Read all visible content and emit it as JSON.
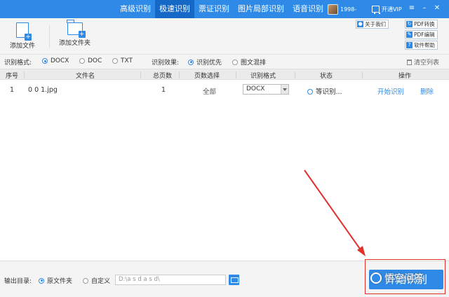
{
  "topbar": {
    "tabs": [
      "高级识别",
      "极速识别",
      "票证识别",
      "图片局部识别",
      "语音识别"
    ],
    "active_tab": "极速识别",
    "user_name": "1998-",
    "vip_label": "开通VIP",
    "color": "#2e8ae6"
  },
  "toolbar": {
    "add_file": "添加文件",
    "add_folder": "添加文件夹",
    "about": "关于我们",
    "pdf_convert": "PDF转换",
    "pdf_edit": "PDF编辑",
    "help": "软件帮助"
  },
  "options": {
    "format_label": "识别格式:",
    "formats": [
      "DOCX",
      "DOC",
      "TXT"
    ],
    "selected_format": "DOCX",
    "effect_label": "识别效果:",
    "effects": [
      "识别优先",
      "图文混排"
    ],
    "selected_effect": "识别优先",
    "clear_list": "清空列表"
  },
  "table": {
    "headers": [
      "序号",
      "文件名",
      "总页数",
      "页数选择",
      "识别格式",
      "状态",
      "操作"
    ],
    "rows": [
      {
        "index": "1",
        "filename": "0 0 1.jpg",
        "pages": "1",
        "page_select": "全部",
        "format": "DOCX",
        "status": "等识别...",
        "action_start": "开始识别",
        "action_delete": "删除"
      }
    ]
  },
  "footer": {
    "output_label": "输出目录:",
    "option_original": "原文件夹",
    "option_custom": "自定义",
    "path_value": "D:\\a s d a s d\\",
    "start_button": "开始识别"
  },
  "watermark": {
    "text": "悟空问答"
  },
  "annotation": {
    "arrow_color": "#e0302a"
  }
}
